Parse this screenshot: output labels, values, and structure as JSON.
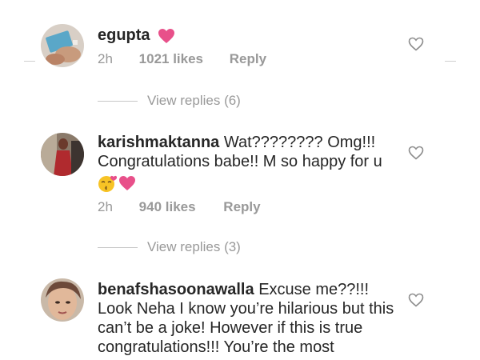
{
  "comments": [
    {
      "username": "egupta",
      "text": "",
      "time": "2h",
      "likes": "1021 likes",
      "reply_label": "Reply",
      "view_replies": "View replies (6)"
    },
    {
      "username": "karishmaktanna",
      "text": "Wat???????? Omg!!! Congratulations babe!! M so happy for u",
      "time": "2h",
      "likes": "940 likes",
      "reply_label": "Reply",
      "view_replies": "View replies (3)"
    },
    {
      "username": "benafshasoonawalla",
      "text": "Excuse me??!!! Look Neha I know you’re hilarious but this can’t be a joke! However if this is true congratulations!!! You’re the most"
    }
  ],
  "colors": {
    "pink_heart": "#e8508a",
    "meta_gray": "#999999"
  },
  "icons": [
    "like-heart-icon",
    "pink-heart-emoji",
    "kissing-face-emoji"
  ]
}
